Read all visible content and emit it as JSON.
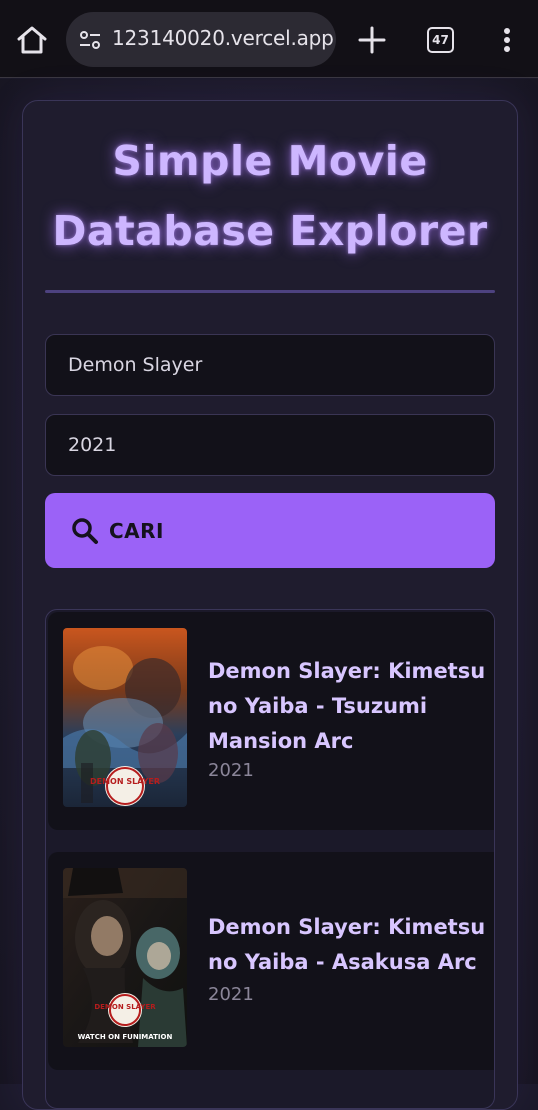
{
  "browser": {
    "url": "123140020.vercel.app",
    "tab_count": "47"
  },
  "app": {
    "title": "Simple Movie Database Explorer",
    "title_line1": "Simple Movie",
    "title_line2": "Database Explorer",
    "accent_color": "#9b62f7"
  },
  "search": {
    "title_value": "Demon Slayer",
    "year_value": "2021",
    "button_label": "CARI"
  },
  "results": [
    {
      "title": "Demon Slayer: Kimetsu no Yaiba - Tsuzumi Mansion Arc",
      "year": "2021"
    },
    {
      "title": "Demon Slayer: Kimetsu no Yaiba - Asakusa Arc",
      "year": "2021"
    }
  ],
  "posters": [
    {
      "logo": "DEMON SLAYER"
    },
    {
      "logo": "DEMON SLAYER",
      "tagline": "WATCH ON FUNIMATION"
    }
  ]
}
